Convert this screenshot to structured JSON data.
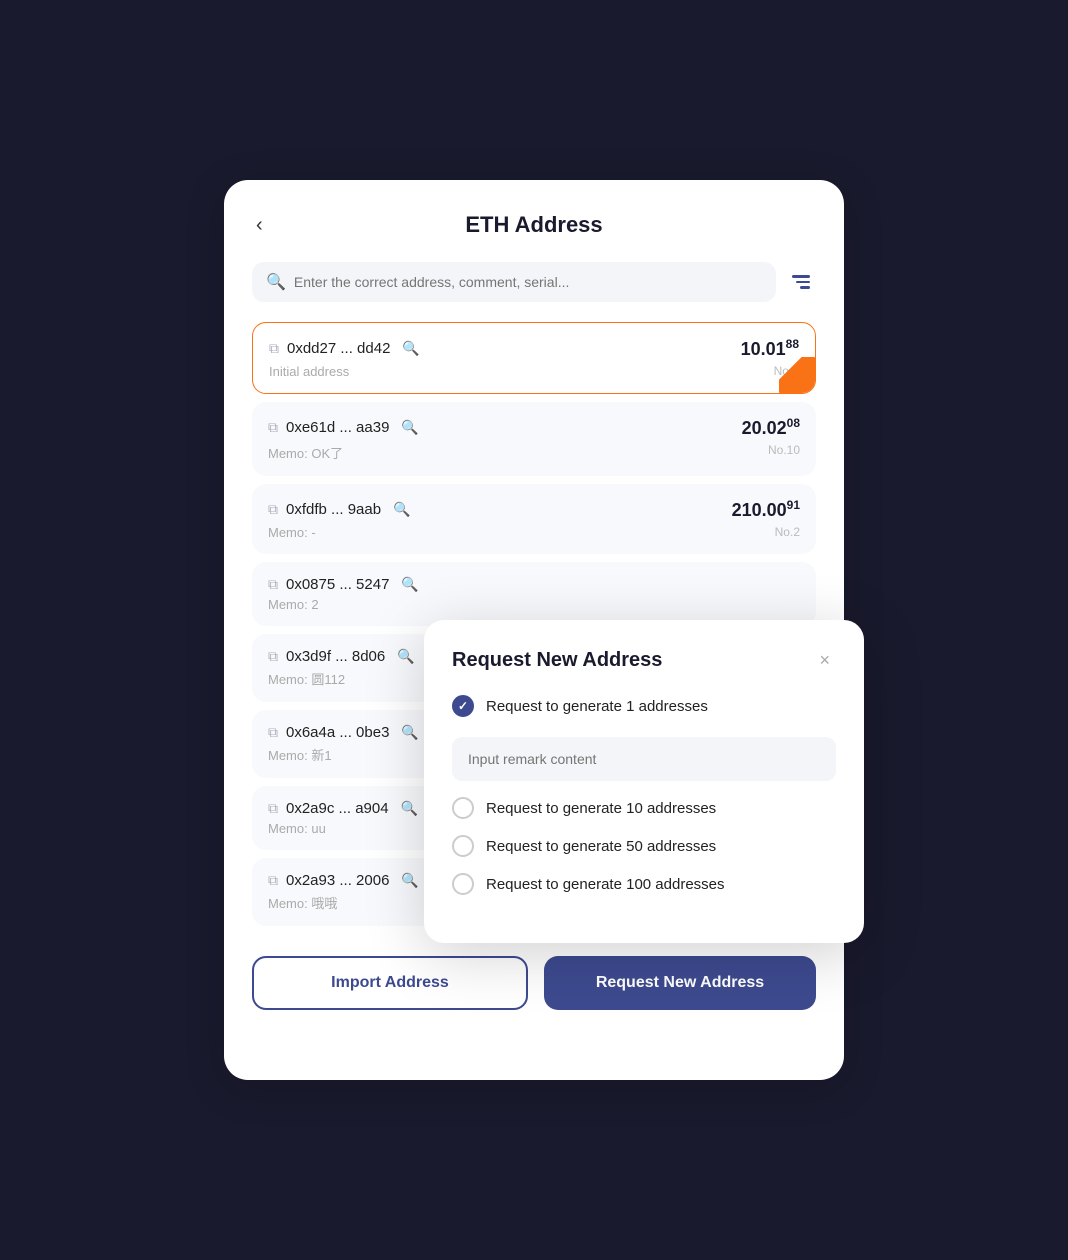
{
  "page": {
    "title": "ETH Address",
    "back_label": "‹"
  },
  "search": {
    "placeholder": "Enter the correct address, comment, serial..."
  },
  "addresses": [
    {
      "hash": "0xdd27 ... dd42",
      "memo": "Initial address",
      "amount_main": "10.01",
      "amount_sup": "88",
      "number": "No.0",
      "active": true
    },
    {
      "hash": "0xe61d ... aa39",
      "memo": "Memo: OK了",
      "amount_main": "20.02",
      "amount_sup": "08",
      "number": "No.10",
      "active": false
    },
    {
      "hash": "0xfdfb ... 9aab",
      "memo": "Memo: -",
      "amount_main": "210.00",
      "amount_sup": "91",
      "number": "No.2",
      "active": false
    },
    {
      "hash": "0x0875 ... 5247",
      "memo": "Memo: 2",
      "amount_main": "",
      "amount_sup": "",
      "number": "",
      "active": false
    },
    {
      "hash": "0x3d9f ... 8d06",
      "memo": "Memo: 圆112",
      "amount_main": "",
      "amount_sup": "",
      "number": "",
      "active": false
    },
    {
      "hash": "0x6a4a ... 0be3",
      "memo": "Memo: 新1",
      "amount_main": "",
      "amount_sup": "",
      "number": "",
      "active": false
    },
    {
      "hash": "0x2a9c ... a904",
      "memo": "Memo: uu",
      "amount_main": "",
      "amount_sup": "",
      "number": "",
      "active": false
    },
    {
      "hash": "0x2a93 ... 2006",
      "memo": "Memo: 哦哦",
      "amount_main": "",
      "amount_sup": "",
      "number": "",
      "active": false
    }
  ],
  "buttons": {
    "import": "Import Address",
    "request": "Request New Address"
  },
  "modal": {
    "title": "Request New Address",
    "close_label": "×",
    "options": [
      {
        "label": "Request to generate 1 addresses",
        "checked": true
      },
      {
        "label": "Request to generate 10 addresses",
        "checked": false
      },
      {
        "label": "Request to generate 50 addresses",
        "checked": false
      },
      {
        "label": "Request to generate 100 addresses",
        "checked": false
      }
    ],
    "remark_placeholder": "Input remark content"
  }
}
